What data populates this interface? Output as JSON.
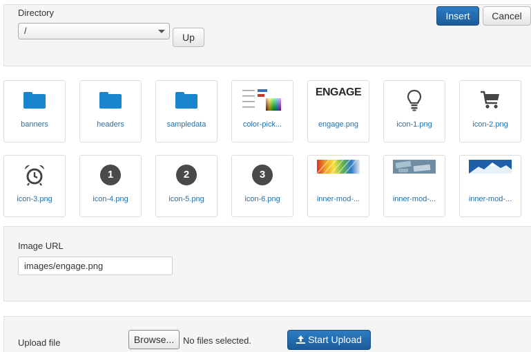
{
  "toolbar": {
    "insert_label": "Insert",
    "cancel_label": "Cancel"
  },
  "directory": {
    "label": "Directory",
    "selected": "/",
    "up_label": "Up"
  },
  "files": [
    {
      "name": "banners",
      "type": "folder"
    },
    {
      "name": "headers",
      "type": "folder"
    },
    {
      "name": "sampledata",
      "type": "folder"
    },
    {
      "name": "color-pick...",
      "type": "image"
    },
    {
      "name": "engage.png",
      "type": "image",
      "thumb_text": "ENGAGE"
    },
    {
      "name": "icon-1.png",
      "type": "image",
      "icon": "lightbulb-icon"
    },
    {
      "name": "icon-2.png",
      "type": "image",
      "icon": "shopping-cart-icon"
    },
    {
      "name": "icon-3.png",
      "type": "image",
      "icon": "alarm-clock-icon"
    },
    {
      "name": "icon-4.png",
      "type": "image",
      "thumb_text": "1"
    },
    {
      "name": "icon-5.png",
      "type": "image",
      "thumb_text": "2"
    },
    {
      "name": "icon-6.png",
      "type": "image",
      "thumb_text": "3"
    },
    {
      "name": "inner-mod-...",
      "type": "image"
    },
    {
      "name": "inner-mod-...",
      "type": "image"
    },
    {
      "name": "inner-mod-...",
      "type": "image"
    }
  ],
  "image_url": {
    "label": "Image URL",
    "value": "images/engage.png"
  },
  "upload": {
    "label": "Upload file",
    "browse_label": "Browse...",
    "no_file_text": "No files selected.",
    "start_label": "Start Upload"
  },
  "colors": {
    "primary": "#1f68ad",
    "folder": "#1a84cf",
    "link": "#1f6fb0"
  }
}
